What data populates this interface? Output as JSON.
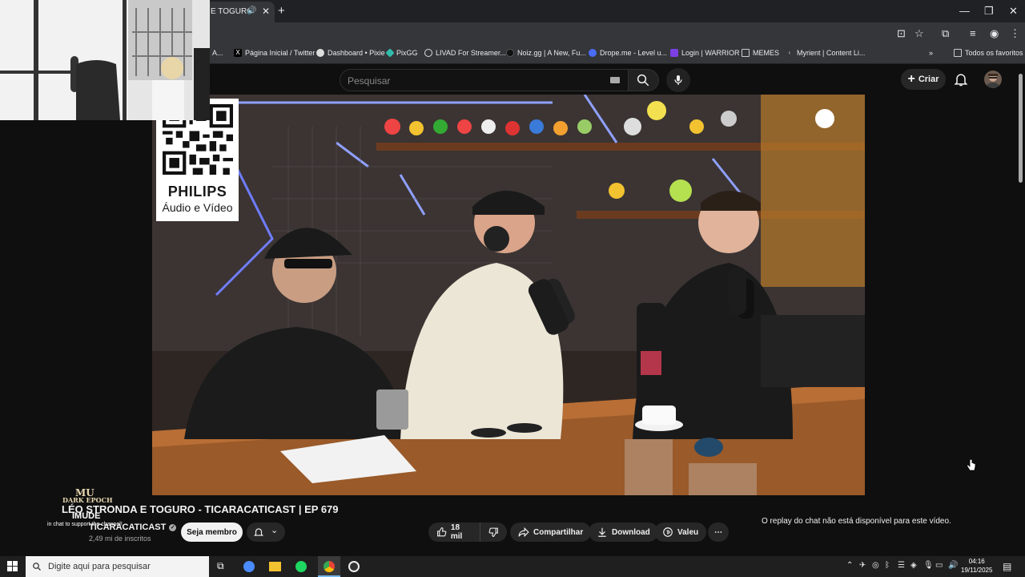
{
  "browser": {
    "tab_title": "E TOGURO",
    "bookmarks": [
      {
        "label": "A...",
        "icon": "bookmark-icon"
      },
      {
        "label": "Página Inicial / Twitter",
        "icon": "x-icon"
      },
      {
        "label": "Dashboard • Pixie",
        "icon": "globe-icon"
      },
      {
        "label": "PixGG",
        "icon": "pix-icon"
      },
      {
        "label": "LIVAD For Streamer...",
        "icon": "gear-icon"
      },
      {
        "label": "Noiz.gg | A New, Fu...",
        "icon": "noiz-icon"
      },
      {
        "label": "Drope.me - Level u...",
        "icon": "drope-icon"
      },
      {
        "label": "Login | WARRIOR",
        "icon": "warrior-icon"
      },
      {
        "label": "MEMES",
        "icon": "folder-icon"
      },
      {
        "label": "Myrient | Content Li...",
        "icon": "myrient-icon"
      }
    ],
    "other_bookmarks": "Todos os favoritos"
  },
  "youtube": {
    "search_placeholder": "Pesquisar",
    "create_label": "Criar",
    "video_title": "LÉO STRONDA E TOGURO - TICARACATICAST | EP 679",
    "channel_name": "TICARACATICAST",
    "subscribers": "2,49 mi de inscritos",
    "join_label": "Seja membro",
    "likes": "18 mil",
    "share_label": "Compartilhar",
    "download_label": "Download",
    "thanks_label": "Valeu",
    "chat_replay_message": "O replay do chat não está disponível para este vídeo."
  },
  "overlay": {
    "sponsor_brand": "PHILIPS",
    "sponsor_sub": "Áudio e Vídeo",
    "game_logo_line1": "MU",
    "game_logo_line2": "DARK EPOCH",
    "streamer_name": "IMUDE",
    "chat_note": "in chat to support the channel!"
  },
  "taskbar": {
    "search_placeholder": "Digite aqui para pesquisar",
    "time": "04:16",
    "date": "19/11/2025"
  }
}
